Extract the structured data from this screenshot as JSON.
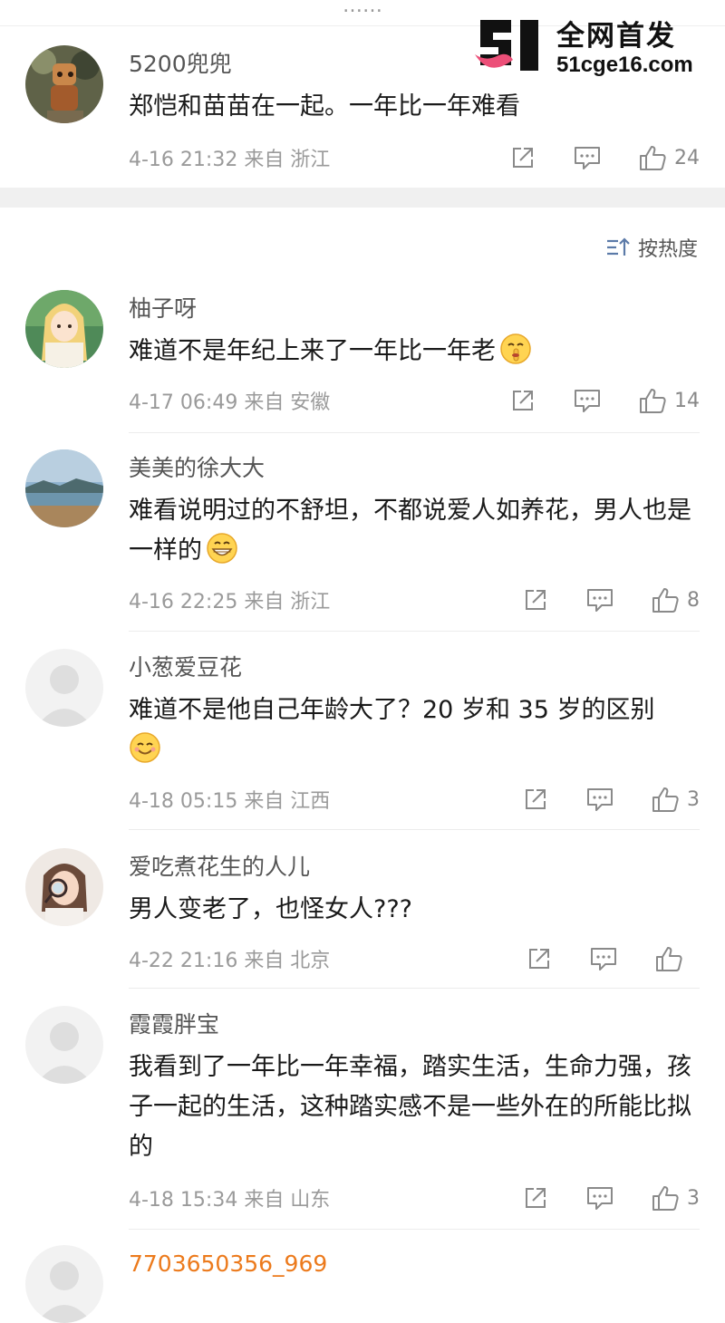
{
  "top_fragment": "……",
  "watermark": {
    "title": "全网首发",
    "url": "51cge16.com"
  },
  "sort_label": "按热度",
  "colors": {
    "username": "#555555",
    "username_highlight": "#ec7a1c",
    "meta_text": "#9a9a9a",
    "icon": "#8a8a8a",
    "separator": "#f0f0f0"
  },
  "comments": [
    {
      "username": "5200兜兜",
      "text": "郑恺和苗苗在一起。一年比一年难看",
      "time_location": "4-16 21:32 来自 浙江",
      "likes": "24",
      "avatar": "toy-figure-avatar"
    },
    {
      "username": "柚子呀",
      "text": "难道不是年纪上来了一年比一年老",
      "emoji": "shush-face-emoji",
      "time_location": "4-17 06:49 来自 安徽",
      "likes": "14",
      "avatar": "anime-girl-avatar"
    },
    {
      "username": "美美的徐大大",
      "text": "难看说明过的不舒坦，不都说爱人如养花，男人也是一样的",
      "emoji": "grin-emoji",
      "time_location": "4-16 22:25 来自 浙江",
      "likes": "8",
      "avatar": "landscape-avatar"
    },
    {
      "username": "小葱爱豆花",
      "text": "难道不是他自己年龄大了？20 岁和 35 岁的区别",
      "emoji": "smile-emoji",
      "time_location": "4-18 05:15 来自 江西",
      "likes": "3",
      "avatar": "default-avatar"
    },
    {
      "username": "爱吃煮花生的人儿",
      "text": "男人变老了，也怪女人???",
      "time_location": "4-22 21:16 来自 北京",
      "likes": "",
      "avatar": "child-magnifier-avatar"
    },
    {
      "username": "霞霞胖宝",
      "text": "我看到了一年比一年幸福，踏实生活，生命力强，孩子一起的生活，这种踏实感不是一些外在的所能比拟的",
      "time_location": "4-18 15:34 来自 山东",
      "likes": "3",
      "avatar": "default-avatar"
    },
    {
      "username": "7703650356_969",
      "avatar": "default-avatar"
    }
  ]
}
